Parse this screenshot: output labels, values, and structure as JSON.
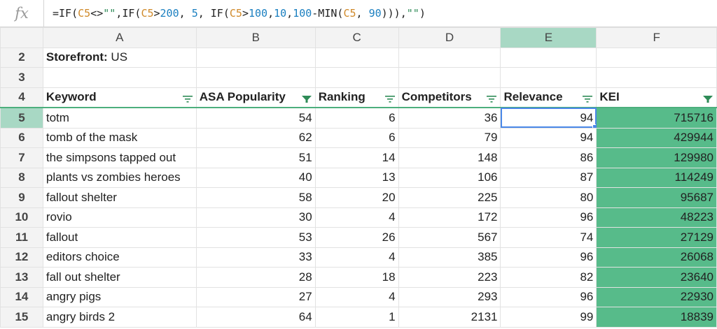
{
  "formula_bar": {
    "fx_label": "fx",
    "parts": [
      {
        "t": "=IF(",
        "c": ""
      },
      {
        "t": "C5",
        "c": "ref"
      },
      {
        "t": "<>",
        "c": ""
      },
      {
        "t": "\"\"",
        "c": "str"
      },
      {
        "t": ",IF(",
        "c": ""
      },
      {
        "t": "C5",
        "c": "ref"
      },
      {
        "t": ">",
        "c": ""
      },
      {
        "t": "200",
        "c": "num"
      },
      {
        "t": ", ",
        "c": ""
      },
      {
        "t": "5",
        "c": "num"
      },
      {
        "t": ", IF(",
        "c": ""
      },
      {
        "t": "C5",
        "c": "ref"
      },
      {
        "t": ">",
        "c": ""
      },
      {
        "t": "100",
        "c": "num"
      },
      {
        "t": ",",
        "c": ""
      },
      {
        "t": "10",
        "c": "num"
      },
      {
        "t": ",",
        "c": ""
      },
      {
        "t": "100",
        "c": "num"
      },
      {
        "t": "-MIN(",
        "c": ""
      },
      {
        "t": "C5",
        "c": "ref"
      },
      {
        "t": ", ",
        "c": ""
      },
      {
        "t": "90",
        "c": "num"
      },
      {
        "t": "))),",
        "c": ""
      },
      {
        "t": "\"\"",
        "c": "str"
      },
      {
        "t": ")",
        "c": ""
      }
    ]
  },
  "columns": [
    "A",
    "B",
    "C",
    "D",
    "E",
    "F"
  ],
  "selected_column": "E",
  "row2": {
    "num": "2",
    "label_bold": "Storefront:",
    "label_rest": " US"
  },
  "row3": {
    "num": "3"
  },
  "header_row": {
    "num": "4",
    "cells": [
      {
        "label": "Keyword",
        "filter_active": false
      },
      {
        "label": "ASA Popularity",
        "filter_active": true
      },
      {
        "label": "Ranking",
        "filter_active": false
      },
      {
        "label": "Competitors",
        "filter_active": false
      },
      {
        "label": "Relevance",
        "filter_active": false
      },
      {
        "label": "KEI",
        "filter_active": true
      }
    ]
  },
  "colors": {
    "filter_icon": "#2e8b57",
    "kei_fill": "#57bb8a",
    "selection": "#4a88e8"
  },
  "active_cell": {
    "row": "5",
    "col": "E"
  },
  "rows": [
    {
      "num": "5",
      "keyword": "totm",
      "popularity": "54",
      "ranking": "6",
      "competitors": "36",
      "relevance": "94",
      "kei": "715716"
    },
    {
      "num": "6",
      "keyword": "tomb of the mask",
      "popularity": "62",
      "ranking": "6",
      "competitors": "79",
      "relevance": "94",
      "kei": "429944"
    },
    {
      "num": "7",
      "keyword": "the simpsons tapped out",
      "popularity": "51",
      "ranking": "14",
      "competitors": "148",
      "relevance": "86",
      "kei": "129980"
    },
    {
      "num": "8",
      "keyword": "plants vs zombies heroes",
      "popularity": "40",
      "ranking": "13",
      "competitors": "106",
      "relevance": "87",
      "kei": "114249"
    },
    {
      "num": "9",
      "keyword": "fallout shelter",
      "popularity": "58",
      "ranking": "20",
      "competitors": "225",
      "relevance": "80",
      "kei": "95687"
    },
    {
      "num": "10",
      "keyword": "rovio",
      "popularity": "30",
      "ranking": "4",
      "competitors": "172",
      "relevance": "96",
      "kei": "48223"
    },
    {
      "num": "11",
      "keyword": "fallout",
      "popularity": "53",
      "ranking": "26",
      "competitors": "567",
      "relevance": "74",
      "kei": "27129"
    },
    {
      "num": "12",
      "keyword": "editors choice",
      "popularity": "33",
      "ranking": "4",
      "competitors": "385",
      "relevance": "96",
      "kei": "26068"
    },
    {
      "num": "13",
      "keyword": "fall out shelter",
      "popularity": "28",
      "ranking": "18",
      "competitors": "223",
      "relevance": "82",
      "kei": "23640"
    },
    {
      "num": "14",
      "keyword": "angry pigs",
      "popularity": "27",
      "ranking": "4",
      "competitors": "293",
      "relevance": "96",
      "kei": "22930"
    },
    {
      "num": "15",
      "keyword": "angry birds 2",
      "popularity": "64",
      "ranking": "1",
      "competitors": "2131",
      "relevance": "99",
      "kei": "18839"
    }
  ]
}
